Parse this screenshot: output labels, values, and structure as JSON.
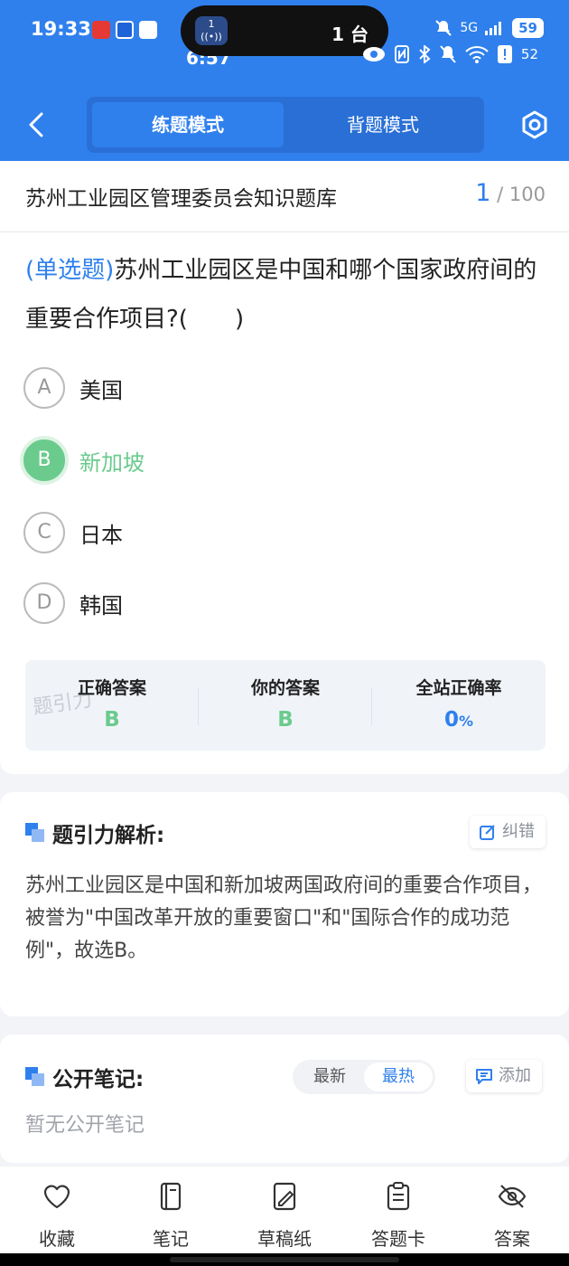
{
  "status_bar": {
    "time": "19:33",
    "secondary_time": "6:57",
    "island_icon_number": "1",
    "island_text": "1 台",
    "network": "5G",
    "battery_primary": "59",
    "battery_secondary": "52"
  },
  "header": {
    "tabs": [
      {
        "label": "练题模式",
        "active": true
      },
      {
        "label": "背题模式",
        "active": false
      }
    ]
  },
  "question_bank": {
    "title": "苏州工业园区管理委员会知识题库",
    "current": "1",
    "total": "/ 100"
  },
  "question": {
    "type": "(单选题)",
    "text": "苏州工业园区是中国和哪个国家政府间的重要合作项目?(　　)",
    "options": [
      {
        "letter": "A",
        "text": "美国",
        "correct": false
      },
      {
        "letter": "B",
        "text": "新加坡",
        "correct": true
      },
      {
        "letter": "C",
        "text": "日本",
        "correct": false
      },
      {
        "letter": "D",
        "text": "韩国",
        "correct": false
      }
    ]
  },
  "stats": {
    "correct_label": "正确答案",
    "correct_value": "B",
    "yours_label": "你的答案",
    "yours_value": "B",
    "rate_label": "全站正确率",
    "rate_value": "0",
    "rate_unit": "%",
    "watermark": "题引力"
  },
  "analysis": {
    "title": "题引力解析:",
    "report_label": "纠错",
    "text": "苏州工业园区是中国和新加坡两国政府间的重要合作项目，被誉为\"中国改革开放的重要窗口\"和\"国际合作的成功范例\"，故选B。"
  },
  "notes": {
    "title": "公开笔记:",
    "sort_latest": "最新",
    "sort_hot": "最热",
    "add_label": "添加",
    "empty_text": "暂无公开笔记"
  },
  "bottom_bar": {
    "items": [
      {
        "label": "收藏",
        "icon": "heart-icon"
      },
      {
        "label": "笔记",
        "icon": "notebook-icon"
      },
      {
        "label": "草稿纸",
        "icon": "draft-paper-icon"
      },
      {
        "label": "答题卡",
        "icon": "answer-card-icon"
      },
      {
        "label": "答案",
        "icon": "eye-off-icon"
      }
    ]
  },
  "colors": {
    "primary": "#2f80ed",
    "correct_green": "#6acb8d"
  }
}
